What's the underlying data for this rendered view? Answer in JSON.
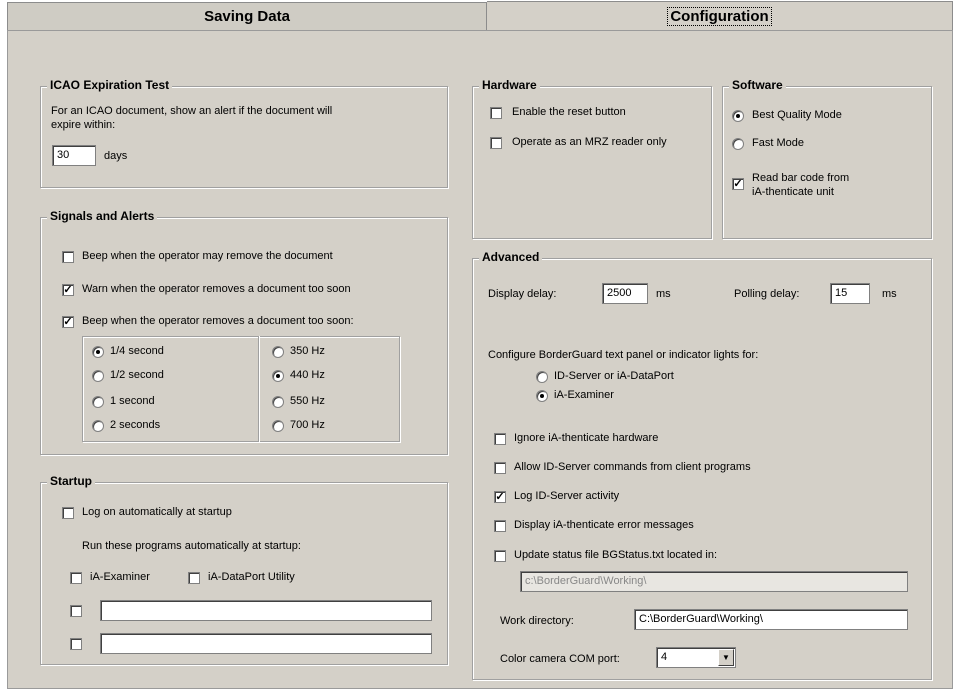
{
  "tabs": {
    "saving": "Saving Data",
    "configuration": "Configuration"
  },
  "icao": {
    "title": "ICAO Expiration Test",
    "description_line1": "For an ICAO document, show an alert if the document will",
    "description_line2": "expire within:",
    "days_value": "30",
    "days_label": "days"
  },
  "signals": {
    "title": "Signals and Alerts",
    "options": [
      {
        "label": "Beep when the operator may remove the document",
        "checked": false
      },
      {
        "label": "Warn when the operator removes a document too soon",
        "checked": true
      },
      {
        "label": "Beep when the operator removes a document too soon:",
        "checked": true
      }
    ],
    "durations": [
      {
        "label": "1/4 second",
        "selected": true
      },
      {
        "label": "1/2 second",
        "selected": false
      },
      {
        "label": "1 second",
        "selected": false
      },
      {
        "label": "2 seconds",
        "selected": false
      }
    ],
    "frequencies": [
      {
        "label": "350 Hz",
        "selected": false
      },
      {
        "label": "440 Hz",
        "selected": true
      },
      {
        "label": "550 Hz",
        "selected": false
      },
      {
        "label": "700 Hz",
        "selected": false
      }
    ]
  },
  "startup": {
    "title": "Startup",
    "logon_label": "Log on automatically at startup",
    "logon_checked": false,
    "run_label": "Run these programs automatically at startup:",
    "examiner_label": "iA-Examiner",
    "dataport_label": "iA-DataPort Utility",
    "custom1_value": "",
    "custom2_value": ""
  },
  "hardware": {
    "title": "Hardware",
    "reset_label": "Enable the reset button",
    "mrz_label": "Operate as an MRZ reader only"
  },
  "software": {
    "title": "Software",
    "best_label": "Best Quality Mode",
    "fast_label": "Fast Mode",
    "barcode_line1": "Read bar code from",
    "barcode_line2": "iA-thenticate unit",
    "barcode_checked": true
  },
  "advanced": {
    "title": "Advanced",
    "display_delay_label": "Display delay:",
    "display_delay_value": "2500",
    "ms1": "ms",
    "polling_delay_label": "Polling delay:",
    "polling_delay_value": "15",
    "ms2": "ms",
    "configure_label": "Configure BorderGuard text panel or indicator lights for:",
    "radio_idserver": "ID-Server or iA-DataPort",
    "radio_examiner": "iA-Examiner",
    "options": [
      {
        "label": "Ignore iA-thenticate hardware",
        "checked": false
      },
      {
        "label": "Allow ID-Server commands from client programs",
        "checked": false
      },
      {
        "label": "Log ID-Server activity",
        "checked": true
      },
      {
        "label": "Display iA-thenticate error messages",
        "checked": false
      },
      {
        "label": "Update status file BGStatus.txt located in:",
        "checked": false
      }
    ],
    "status_path": "c:\\BorderGuard\\Working\\",
    "work_dir_label": "Work directory:",
    "work_dir_value": "C:\\BorderGuard\\Working\\",
    "com_label": "Color camera COM port:",
    "com_value": "4"
  },
  "glyphs": {
    "check": "✓",
    "dropdown": "▼"
  }
}
